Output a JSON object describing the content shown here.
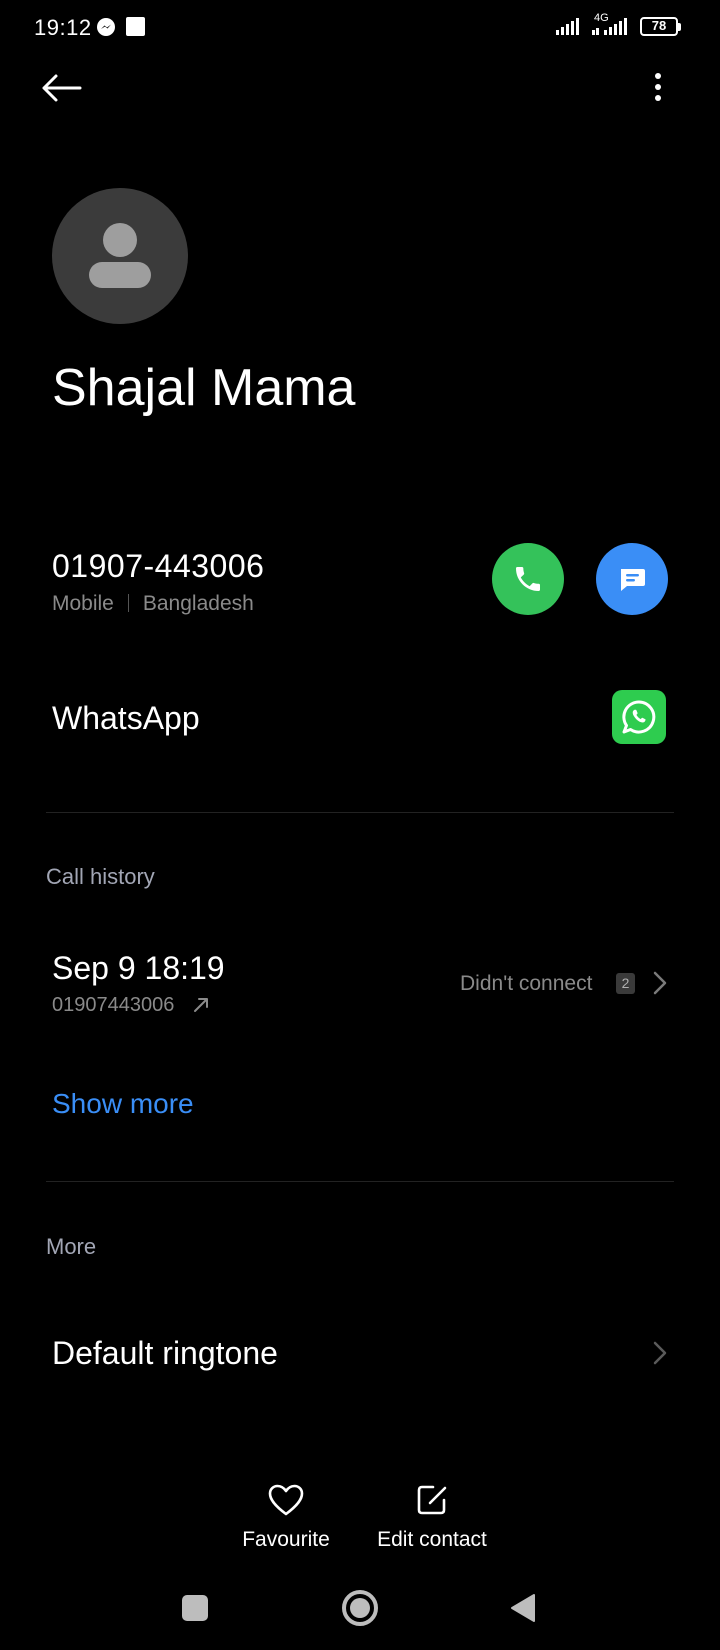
{
  "status_bar": {
    "time": "19:12",
    "network": "4G",
    "battery": "78",
    "icons": [
      "messenger-icon",
      "notification-square-icon",
      "signal-icon",
      "signal-4g-icon",
      "battery-icon"
    ]
  },
  "top_bar": {
    "back_icon": "arrow-left-icon",
    "menu_icon": "more-vertical-icon"
  },
  "contact": {
    "name": "Shajal Mama",
    "avatar_icon": "person-icon"
  },
  "phone": {
    "number": "01907-443006",
    "type": "Mobile",
    "region": "Bangladesh",
    "call_icon": "phone-icon",
    "message_icon": "message-icon",
    "colors": {
      "call": "#34c25a",
      "message": "#3a8ef6"
    }
  },
  "whatsapp": {
    "label": "WhatsApp",
    "icon": "whatsapp-icon",
    "color": "#2ecc4f"
  },
  "call_history": {
    "title": "Call history",
    "entries": [
      {
        "datetime": "Sep 9 18:19",
        "number": "01907443006",
        "direction_icon": "outgoing-arrow-icon",
        "status": "Didn't connect",
        "count": "2"
      }
    ],
    "show_more": "Show more"
  },
  "more": {
    "title": "More",
    "items": [
      {
        "label": "Default ringtone"
      }
    ]
  },
  "actions": {
    "favourite": {
      "label": "Favourite",
      "icon": "heart-icon"
    },
    "edit": {
      "label": "Edit contact",
      "icon": "edit-icon"
    }
  },
  "nav": {
    "icons": [
      "recents-square-icon",
      "home-circle-icon",
      "back-triangle-icon"
    ]
  }
}
